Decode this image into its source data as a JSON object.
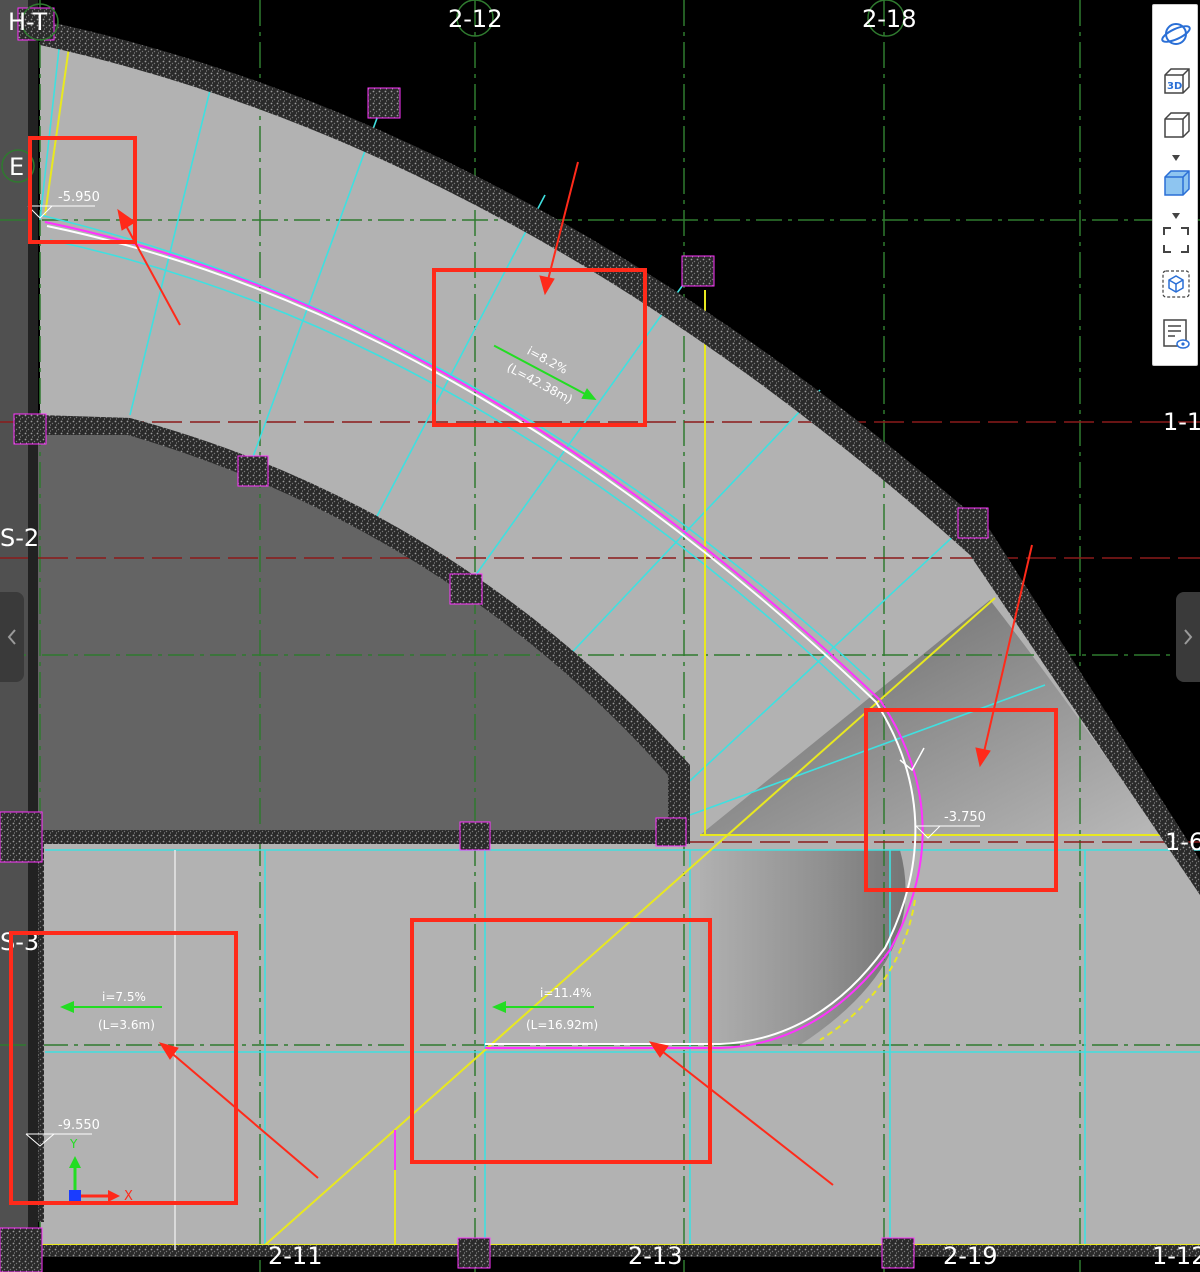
{
  "grid_labels": {
    "h_t": "H-T",
    "c_2_12": "2-12",
    "c_2_18": "2-18",
    "e": "E",
    "s_2": "S-2",
    "s_3": "S-3",
    "c_1_1": "1-1",
    "c_1_6": "1-6",
    "c_2_11": "2-11",
    "c_2_13": "2-13",
    "c_2_19": "2-19",
    "c_1_12": "1-12"
  },
  "elevations": {
    "top_left": "-5.950",
    "right": "-3.750",
    "bottom_left": "-9.550"
  },
  "slopes": {
    "curved_ramp": {
      "grade": "i=8.2%",
      "length": "(L=42.38m)"
    },
    "left_ramp": {
      "grade": "i=7.5%",
      "length": "(L=3.6m)"
    },
    "middle_ramp": {
      "grade": "i=11.4%",
      "length": "(L=16.92m)"
    }
  },
  "ucs": {
    "x_label": "X",
    "y_label": "Y"
  },
  "toolbar": {
    "icons": [
      "orbit-icon",
      "view-3d-icon",
      "wireframe-cube-icon",
      "shaded-cube-icon",
      "fullscreen-icon",
      "view-cube-icon",
      "properties-icon"
    ],
    "label_3d": "3D"
  },
  "colors": {
    "background": "#000000",
    "slab": "#b2b2b2",
    "dark_area": "#646464",
    "grid_green": "#2f7a2f",
    "grid_red": "#8b1a1a",
    "beam_cyan": "#3fe0e0",
    "edge_yellow": "#e8e820",
    "annotation_red": "#ff2a1a",
    "slope_arrow": "#22dd22",
    "magenta": "#ff33ff"
  }
}
